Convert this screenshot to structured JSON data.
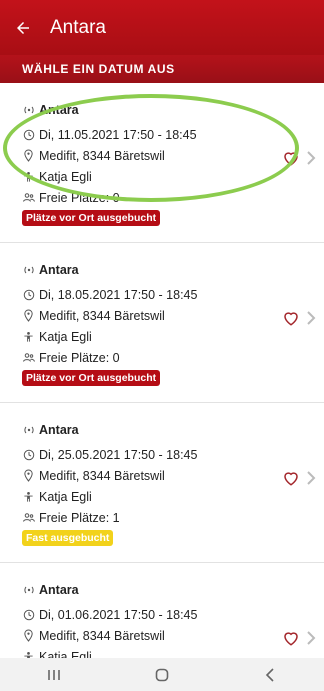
{
  "header": {
    "title": "Antara"
  },
  "subheader": {
    "label": "WÄHLE EIN DATUM AUS"
  },
  "items": [
    {
      "course": "Antara",
      "datetime": "Di, 11.05.2021 17:50 - 18:45",
      "location": "Medifit, 8344 Bäretswil",
      "instructor": "Katja Egli",
      "spots": "Freie Plätze: 0",
      "badge": "Plätze vor Ort ausgebucht",
      "badge_color": "#b50d15"
    },
    {
      "course": "Antara",
      "datetime": "Di, 18.05.2021 17:50 - 18:45",
      "location": "Medifit, 8344 Bäretswil",
      "instructor": "Katja Egli",
      "spots": "Freie Plätze: 0",
      "badge": "Plätze vor Ort ausgebucht",
      "badge_color": "#b50d15"
    },
    {
      "course": "Antara",
      "datetime": "Di, 25.05.2021 17:50 - 18:45",
      "location": "Medifit, 8344 Bäretswil",
      "instructor": "Katja Egli",
      "spots": "Freie Plätze: 1",
      "badge": "Fast ausgebucht",
      "badge_color": "#f2d21b"
    },
    {
      "course": "Antara",
      "datetime": "Di, 01.06.2021 17:50 - 18:45",
      "location": "Medifit, 8344 Bäretswil",
      "instructor": "Katja Egli",
      "spots": "",
      "badge": "",
      "badge_color": ""
    }
  ],
  "colors": {
    "brand": "#b4121a",
    "highlight": "#8ccc4e"
  }
}
